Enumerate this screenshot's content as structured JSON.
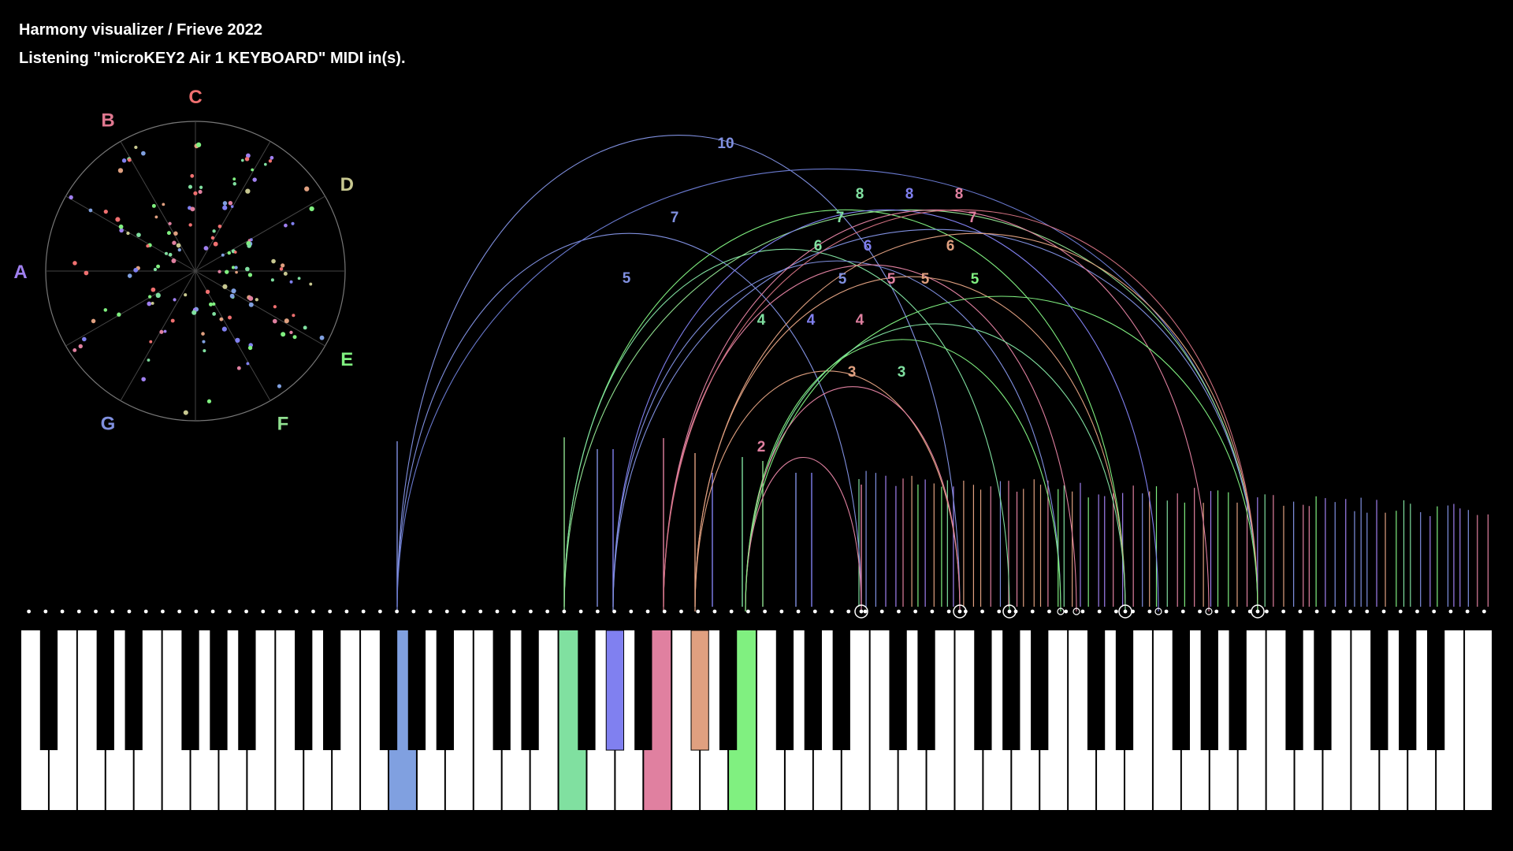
{
  "header": {
    "title": "Harmony visualizer  /  Frieve 2022",
    "status": "Listening \"microKEY2 Air 1 KEYBOARD\" MIDI in(s)."
  },
  "colors": {
    "background": "#000000",
    "C": "#f07070",
    "D": "#c8c890",
    "E": "#80f080",
    "F": "#90e090",
    "G": "#8090e0",
    "A": "#a080f0",
    "B": "#e07890",
    "active_keys": [
      "#80a0e0",
      "#80e0a0",
      "#8080f0",
      "#e080a0",
      "#e0a080",
      "#80f080"
    ]
  },
  "circle": {
    "labels": [
      "C",
      "D",
      "E",
      "F",
      "G",
      "A",
      "B"
    ]
  },
  "keyboard": {
    "white_key_count": 52,
    "active_white_keys": [
      {
        "index": 13,
        "color": "#80a0e0"
      },
      {
        "index": 19,
        "color": "#80e0a0"
      },
      {
        "index": 22,
        "color": "#e080a0"
      },
      {
        "index": 25,
        "color": "#80f080"
      }
    ],
    "active_black_keys": [
      {
        "after_white": 20,
        "color": "#8080f0"
      },
      {
        "after_white": 23,
        "color": "#e0a080"
      }
    ]
  },
  "arcs": {
    "labels": [
      "10",
      "7",
      "5",
      "8",
      "8",
      "8",
      "7",
      "7",
      "6",
      "6",
      "6",
      "5",
      "5",
      "5",
      "5",
      "4",
      "4",
      "4",
      "3",
      "3",
      "2"
    ]
  }
}
